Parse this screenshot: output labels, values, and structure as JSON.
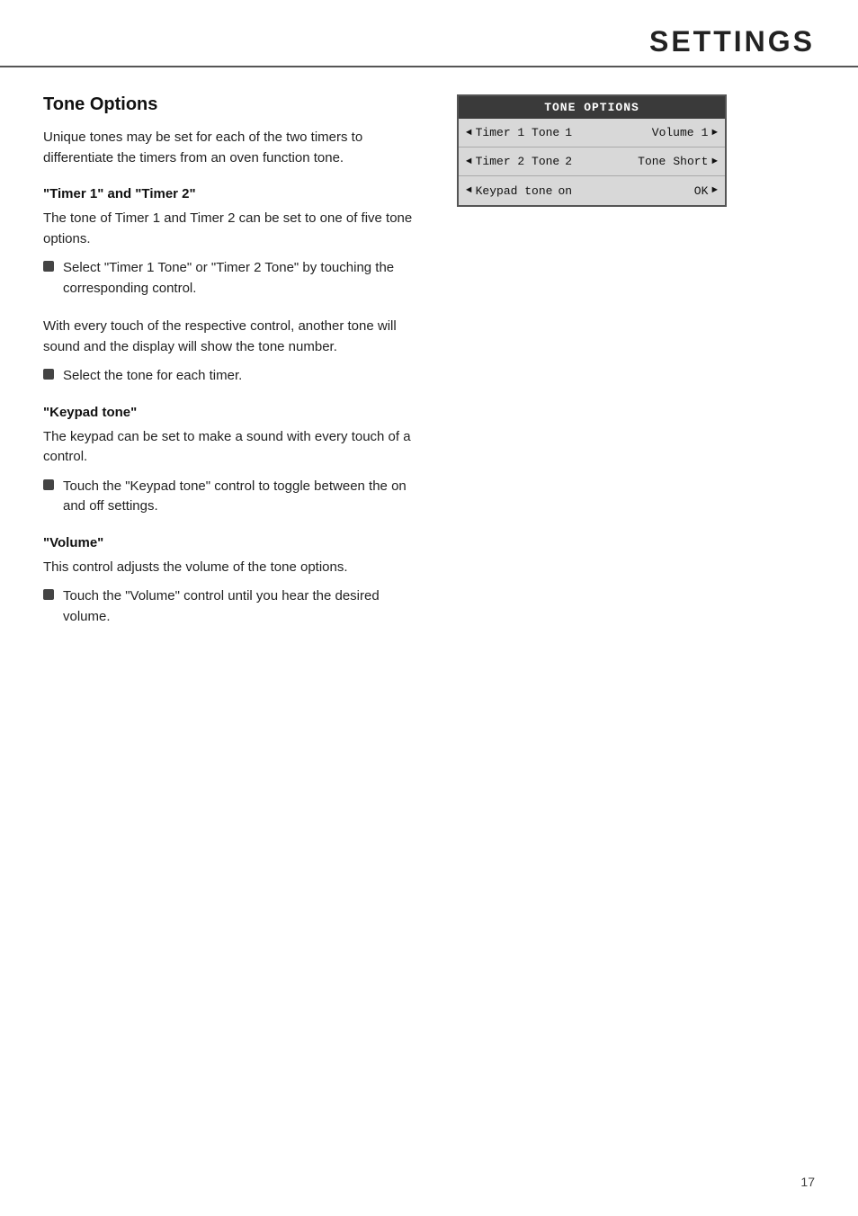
{
  "header": {
    "title": "SETTINGS"
  },
  "page_number": "17",
  "left_column": {
    "section_title": "Tone Options",
    "intro_text": "Unique tones may be set for each of the two timers to differentiate the timers from an oven function tone.",
    "subsections": [
      {
        "id": "timer-section",
        "title": "\"Timer 1\" and \"Timer 2\"",
        "body": "The tone of Timer 1 and Timer 2 can be set to one of five tone options.",
        "bullets": [
          "Select \"Timer 1 Tone\" or \"Timer 2 Tone\" by touching the corresponding control."
        ]
      },
      {
        "id": "mid-text",
        "body": "With every touch of the respective control, another tone will sound and the display will show the tone number.",
        "bullets": [
          "Select the tone for each timer."
        ]
      },
      {
        "id": "keypad-section",
        "title": "\"Keypad tone\"",
        "body": "The keypad can be set to make a sound with every touch of a control.",
        "bullets": [
          "Touch the \"Keypad tone\" control to toggle between the on and off settings."
        ]
      },
      {
        "id": "volume-section",
        "title": "\"Volume\"",
        "body": "This control adjusts the volume of the tone options.",
        "bullets": [
          "Touch the \"Volume\" control until you hear the desired volume."
        ]
      }
    ]
  },
  "display_panel": {
    "header": "TONE OPTIONS",
    "rows": [
      {
        "arrow_left": "◄",
        "label": "Timer 1 Tone",
        "value_left": "1",
        "param_label": "Volume",
        "param_value": "1",
        "arrow_right": "►"
      },
      {
        "arrow_left": "◄",
        "label": "Timer 2 Tone",
        "value_left": "2",
        "param_label": "Tone",
        "param_value": "Short",
        "arrow_right": "►"
      },
      {
        "arrow_left": "◄",
        "label": "Keypad tone",
        "value_left": "on",
        "param_label": "",
        "param_value": "OK",
        "arrow_right": "►"
      }
    ]
  }
}
